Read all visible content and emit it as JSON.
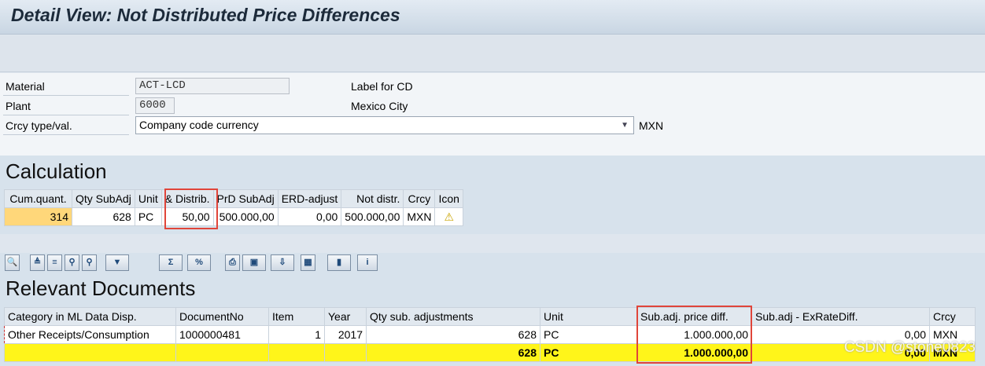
{
  "window": {
    "title": "Detail View: Not Distributed Price Differences"
  },
  "header": {
    "material_label": "Material",
    "material_value": "ACT-LCD",
    "material_desc": "Label for CD",
    "plant_label": "Plant",
    "plant_value": "6000",
    "plant_desc": "Mexico City",
    "crcy_label": "Crcy type/val.",
    "crcy_value": "Company code currency",
    "crcy_code": "MXN"
  },
  "calculation": {
    "title": "Calculation",
    "columns": [
      "Cum.quant.",
      "Qty SubAdj",
      "Unit",
      "& Distrib.",
      "PrD SubAdj",
      "ERD-adjust",
      "Not distr.",
      "Crcy",
      "Icon"
    ],
    "row": [
      "314",
      "628",
      "PC",
      "50,00",
      "500.000,00",
      "0,00",
      "500.000,00",
      "MXN",
      "⚠"
    ]
  },
  "toolbar": {
    "icons": [
      "details-icon",
      "sort-ascending-icon",
      "sort-descending-icon",
      "find-icon",
      "find-next-icon",
      "filter-icon",
      "total-icon",
      "subtotal-icon",
      "print-icon",
      "views-icon",
      "export-icon",
      "layout-icon",
      "graphic-icon",
      "info-icon"
    ],
    "glyphs": [
      "🔍",
      "≜",
      "≡",
      "⚲",
      "⚲",
      "▼",
      "Σ",
      "%",
      "⎙",
      "▣",
      "⇩",
      "▦",
      "▮",
      "i"
    ]
  },
  "documents": {
    "title": "Relevant Documents",
    "columns": [
      "Category in ML Data Disp.",
      "DocumentNo",
      "Item",
      "Year",
      "Qty sub. adjustments",
      "Unit",
      "Sub.adj. price diff.",
      "Sub.adj - ExRateDiff.",
      "Crcy"
    ],
    "rows": [
      [
        "Other Receipts/Consumption",
        "1000000481",
        "1",
        "2017",
        "628",
        "PC",
        "1.000.000,00",
        "0,00",
        "MXN"
      ]
    ],
    "total": {
      "qty": "628",
      "unit": "PC",
      "price_diff": "1.000.000,00",
      "exrate": "0,00",
      "crcy": "MXN"
    }
  },
  "watermark": "CSDN @stone0823",
  "colors": {
    "accent_red": "#e0453a",
    "total_yellow": "#fff51a",
    "highlight_orange": "#ffd77a"
  }
}
